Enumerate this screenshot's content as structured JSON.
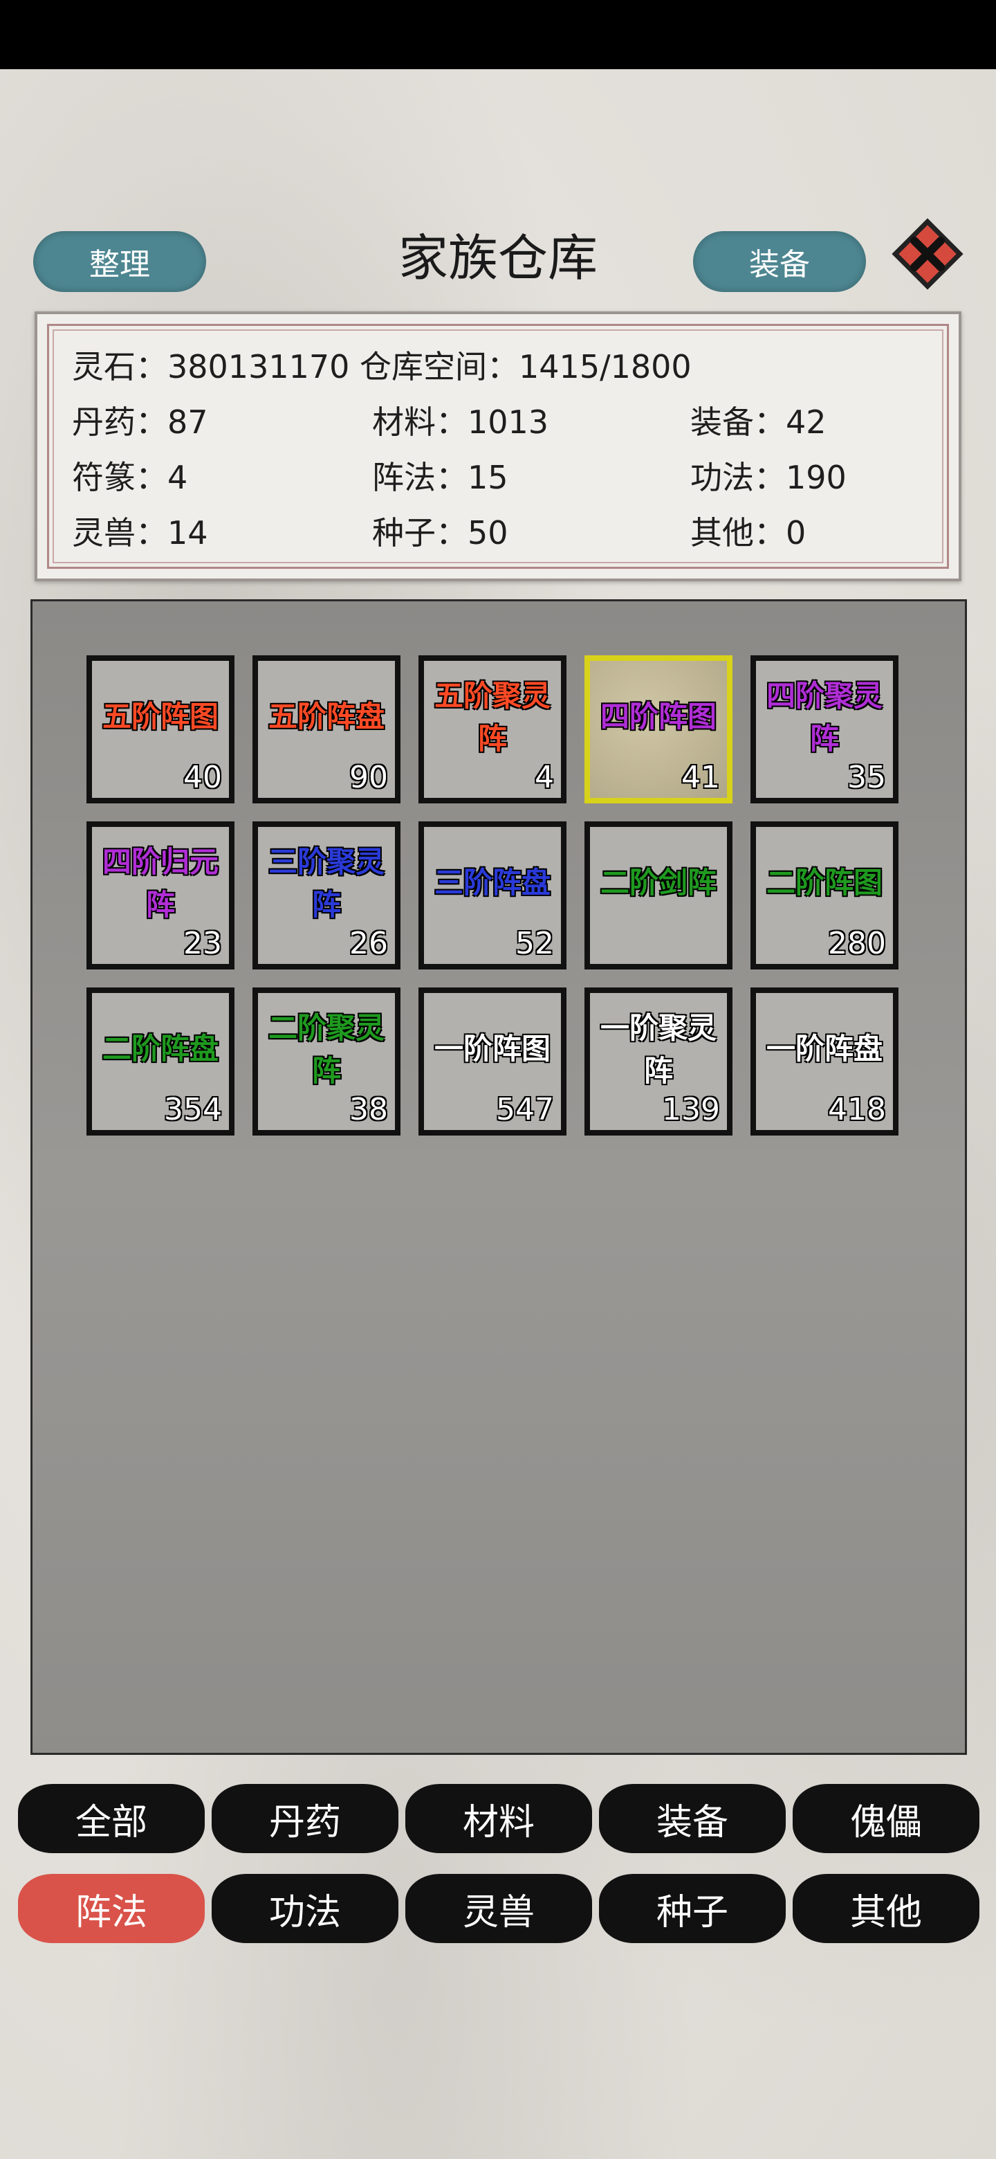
{
  "header": {
    "title": "家族仓库",
    "sort_label": "整理",
    "equip_label": "装备"
  },
  "stats": {
    "line1": "灵石：380131170 仓库空间：1415/1800",
    "rows": [
      [
        "丹药：87",
        "材料：1013",
        "装备：42"
      ],
      [
        "符篆：4",
        "阵法：15",
        "功法：190"
      ],
      [
        "灵兽：14",
        "种子：50",
        "其他：0"
      ]
    ]
  },
  "items": [
    {
      "name": "五阶阵图",
      "count": "40",
      "color": "#ff4a25",
      "lines": 1
    },
    {
      "name": "五阶阵盘",
      "count": "90",
      "color": "#ff4a25",
      "lines": 1
    },
    {
      "name": "五阶聚灵阵",
      "count": "4",
      "color": "#ff4a25",
      "lines": 2
    },
    {
      "name": "四阶阵图",
      "count": "41",
      "color": "#b02ed6",
      "lines": 1,
      "selected": true
    },
    {
      "name": "四阶聚灵阵",
      "count": "35",
      "color": "#b02ed6",
      "lines": 2
    },
    {
      "name": "四阶归元阵",
      "count": "23",
      "color": "#b02ed6",
      "lines": 2
    },
    {
      "name": "三阶聚灵阵",
      "count": "26",
      "color": "#2a3ad8",
      "lines": 2
    },
    {
      "name": "三阶阵盘",
      "count": "52",
      "color": "#2a3ad8",
      "lines": 1
    },
    {
      "name": "二阶剑阵",
      "count": "",
      "color": "#1f9a1f",
      "lines": 1
    },
    {
      "name": "二阶阵图",
      "count": "280",
      "color": "#1f9a1f",
      "lines": 1
    },
    {
      "name": "二阶阵盘",
      "count": "354",
      "color": "#1f9a1f",
      "lines": 1
    },
    {
      "name": "二阶聚灵阵",
      "count": "38",
      "color": "#1f9a1f",
      "lines": 2
    },
    {
      "name": "一阶阵图",
      "count": "547",
      "color": "#ffffff",
      "lines": 1
    },
    {
      "name": "一阶聚灵阵",
      "count": "139",
      "color": "#ffffff",
      "lines": 2
    },
    {
      "name": "一阶阵盘",
      "count": "418",
      "color": "#ffffff",
      "lines": 1
    }
  ],
  "tabs": {
    "row1": [
      "全部",
      "丹药",
      "材料",
      "装备",
      "傀儡"
    ],
    "row2": [
      "阵法",
      "功法",
      "灵兽",
      "种子",
      "其他"
    ],
    "active": "阵法"
  },
  "colors": {
    "accent_button": "#4d8691",
    "active_tab": "#d9534a",
    "selected_border": "#d8d21a"
  }
}
